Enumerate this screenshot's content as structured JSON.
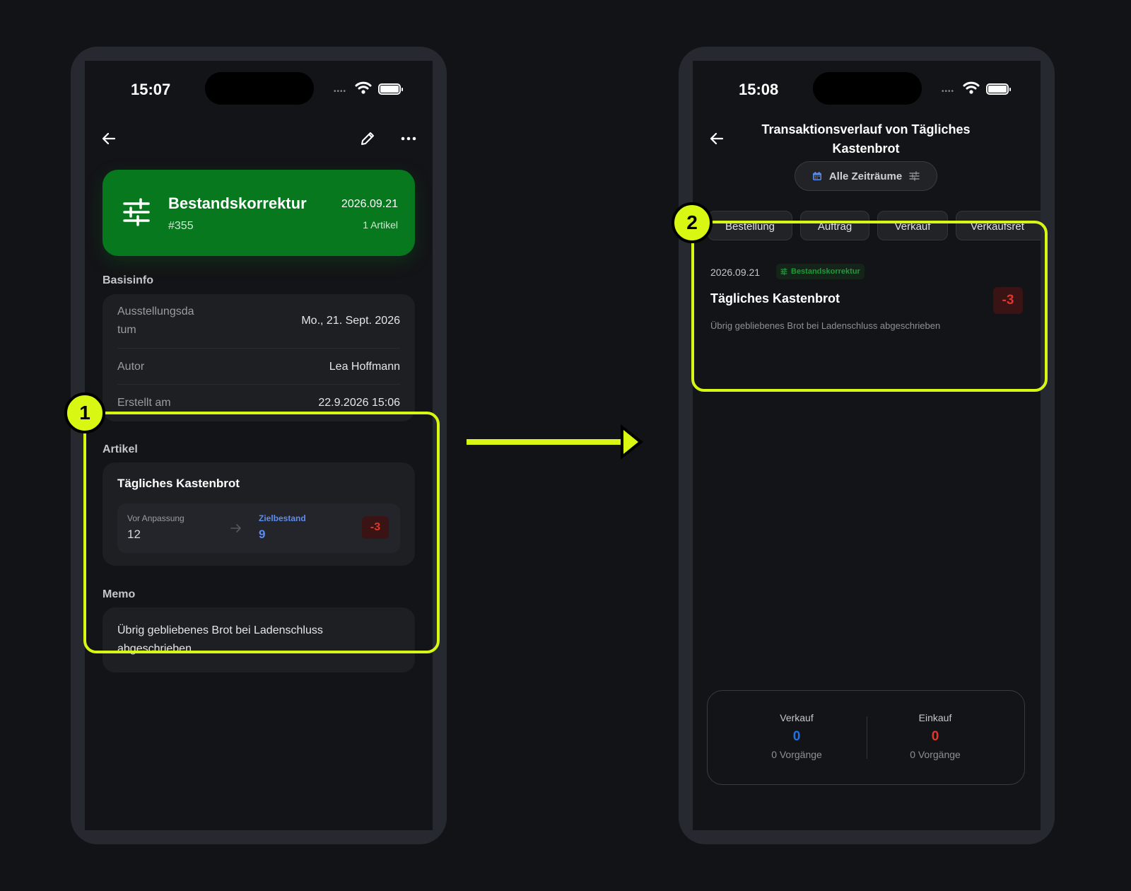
{
  "left_screen": {
    "status": {
      "time": "15:07"
    },
    "hero": {
      "title": "Bestandskorrektur",
      "number": "#355",
      "date": "2026.09.21",
      "count": "1 Artikel"
    },
    "basic_info": {
      "label": "Basisinfo",
      "rows": [
        {
          "key": "Ausstellungsda tum",
          "key_line1": "Ausstellungsda",
          "key_line2": "tum",
          "value": "Mo., 21. Sept. 2026"
        },
        {
          "key": "Autor",
          "value": "Lea Hoffmann"
        },
        {
          "key": "Erstellt am",
          "value": "22.9.2026 15:06"
        }
      ]
    },
    "items": {
      "label": "Artikel",
      "item": {
        "name": "Tägliches Kastenbrot",
        "before_label": "Vor Anpassung",
        "before_value": "12",
        "target_label": "Zielbestand",
        "target_value": "9",
        "delta": "-3"
      }
    },
    "memo": {
      "label": "Memo",
      "text": "Übrig gebliebenes Brot bei Ladenschluss abgeschrieben"
    }
  },
  "right_screen": {
    "status": {
      "time": "15:08"
    },
    "title": "Transaktionsverlauf von Tägliches Kastenbrot",
    "title_line1": "Transaktionsverlauf von Tägliches",
    "title_line2": "Kastenbrot",
    "period": "Alle Zeiträume",
    "tabs": [
      "Bestellung",
      "Auftrag",
      "Verkauf",
      "Verkaufsret"
    ],
    "transaction": {
      "date": "2026.09.21",
      "type": "Bestandskorrektur",
      "name": "Tägliches Kastenbrot",
      "delta": "-3",
      "memo": "Übrig gebliebenes Brot bei Ladenschluss abgeschrieben"
    },
    "summary": {
      "sale": {
        "label": "Verkauf",
        "value": "0",
        "count": "0 Vorgänge"
      },
      "purchase": {
        "label": "Einkauf",
        "value": "0",
        "count": "0 Vorgänge"
      }
    }
  },
  "annotations": {
    "step1": "1",
    "step2": "2"
  },
  "colors": {
    "accent_green": "#07781e",
    "highlight": "#d8f712",
    "negative": "#e0362c",
    "target_blue": "#5b8def",
    "sale_blue": "#1a73e8"
  }
}
